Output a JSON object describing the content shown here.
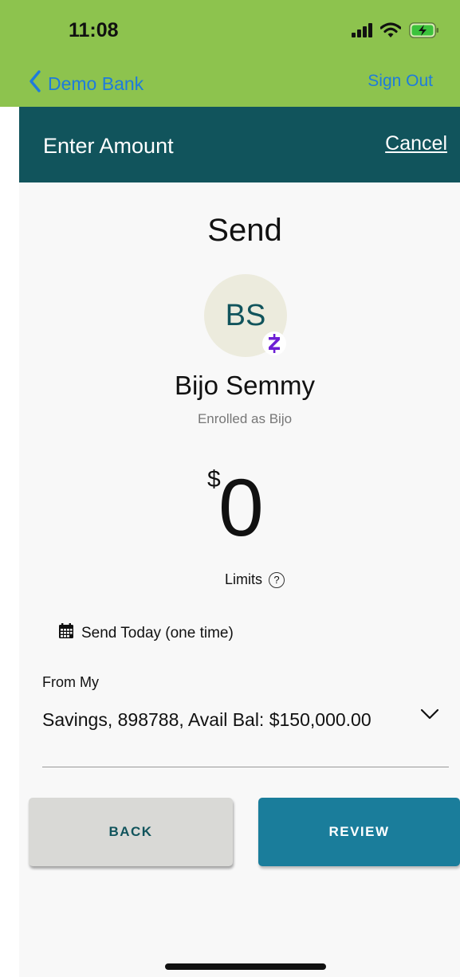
{
  "status_bar": {
    "time": "11:08"
  },
  "nav": {
    "back_label": "Demo Bank",
    "signout_label": "Sign Out"
  },
  "header": {
    "title": "Enter Amount",
    "cancel_label": "Cancel"
  },
  "payment": {
    "title": "Send",
    "recipient_initials": "BS",
    "recipient_name": "Bijo Semmy",
    "enrolled_as": "Enrolled as Bijo",
    "currency_symbol": "$",
    "amount": "0",
    "limits_label": "Limits",
    "limits_help_glyph": "?",
    "send_date": "Send Today (one time)"
  },
  "from": {
    "label": "From My",
    "account": "Savings, 898788, Avail Bal: $150,000.00"
  },
  "buttons": {
    "back_label": "BACK",
    "review_label": "REVIEW"
  },
  "colors": {
    "brand_green": "#8dc34e",
    "header_teal": "#11545c",
    "link_blue": "#1e7bdc",
    "review_blue": "#1a7d9b",
    "zelle_purple": "#6d1ed4"
  }
}
